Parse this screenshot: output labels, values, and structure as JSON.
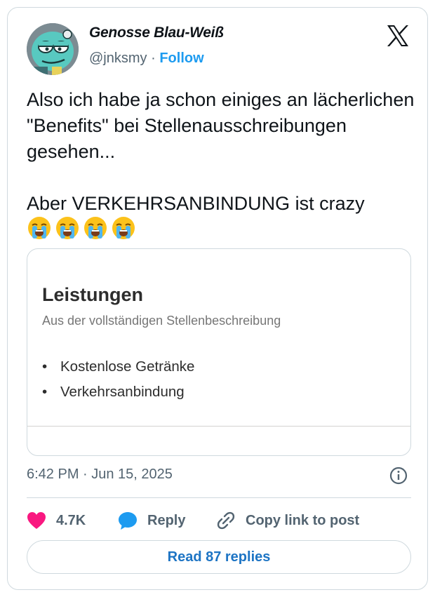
{
  "author": {
    "display_name": "Genosse Blau-Weiß",
    "handle": "@jnksmy",
    "separator": "·",
    "follow_label": "Follow"
  },
  "tweet": {
    "text": "Also ich habe ja schon einiges an lächerlichen \"Benefits\" bei Stellenausschreibungen gesehen...\n\nAber VERKEHRSANBINDUNG ist crazy",
    "emojis": [
      "loudly-crying-face",
      "loudly-crying-face",
      "loudly-crying-face",
      "loudly-crying-face"
    ],
    "timestamp": "6:42 PM · Jun 15, 2025"
  },
  "media": {
    "title": "Leistungen",
    "subtitle": "Aus der vollständigen Stellenbeschreibung",
    "bullet_glyph": "•",
    "items": [
      "Kostenlose Getränke",
      "Verkehrsanbindung"
    ]
  },
  "actions": {
    "like_count": "4.7K",
    "reply_label": "Reply",
    "copy_link_label": "Copy link to post"
  },
  "footer": {
    "read_replies_label": "Read 87 replies"
  },
  "colors": {
    "like_heart": "#f91880",
    "reply_bubble": "#1d9bf0",
    "follow_link": "#1d9bf0",
    "read_replies_text": "#1d74c4",
    "border": "#cfd9de",
    "secondary_text": "#536471"
  },
  "icons": {
    "platform_logo": "x-logo-icon",
    "info": "info-icon",
    "like": "heart-icon",
    "reply": "speech-bubble-icon",
    "copy_link": "link-icon"
  }
}
